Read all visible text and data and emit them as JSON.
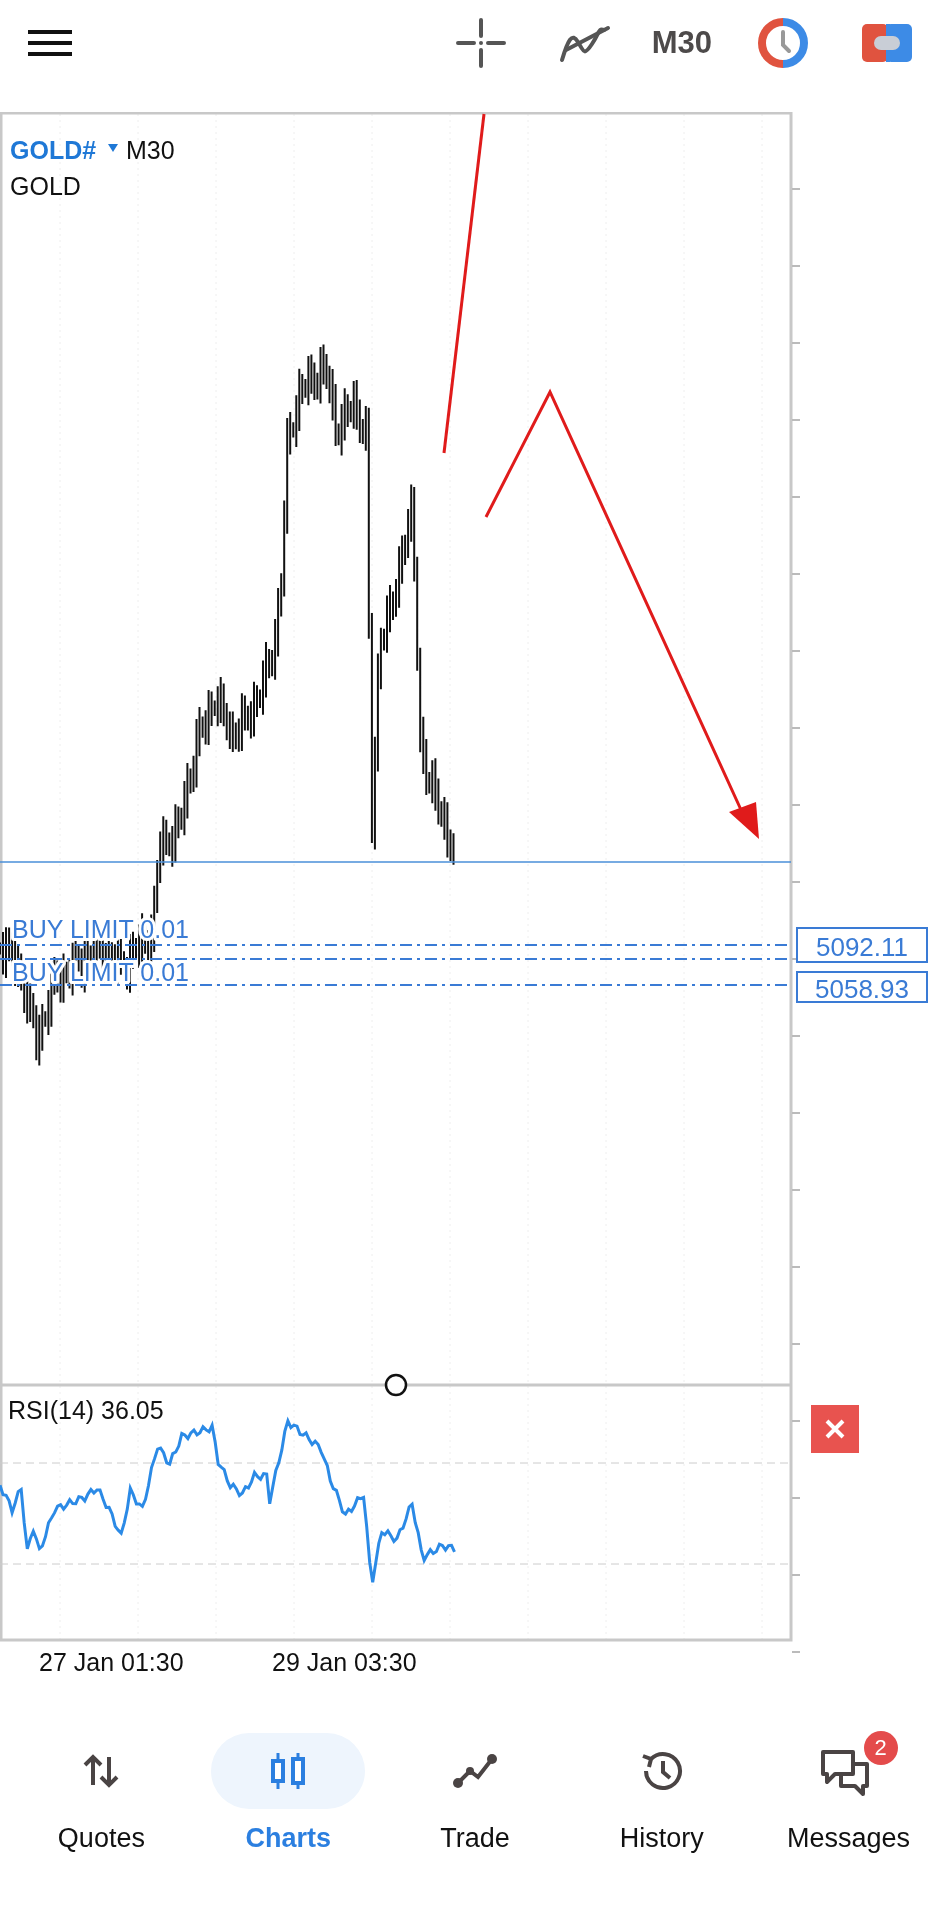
{
  "toolbar": {
    "timeframe": "M30"
  },
  "chart": {
    "symbol": "GOLD#",
    "timeframe": "M30",
    "description": "GOLD",
    "orders": [
      {
        "label": "BUY LIMIT 0.01",
        "price": "5092.11"
      },
      {
        "label": "BUY LIMIT 0.01",
        "price": "5058.93"
      }
    ],
    "indicator": {
      "label": "RSI(14) 36.05"
    },
    "date_labels": [
      "27 Jan 01:30",
      "29 Jan 03:30"
    ]
  },
  "nav": [
    {
      "label": "Quotes",
      "kind": "quotes",
      "selected": false
    },
    {
      "label": "Charts",
      "kind": "charts",
      "selected": true
    },
    {
      "label": "Trade",
      "kind": "trade",
      "selected": false
    },
    {
      "label": "History",
      "kind": "history",
      "selected": false
    },
    {
      "label": "Messages",
      "kind": "messages",
      "selected": false,
      "badge": "2"
    }
  ]
}
